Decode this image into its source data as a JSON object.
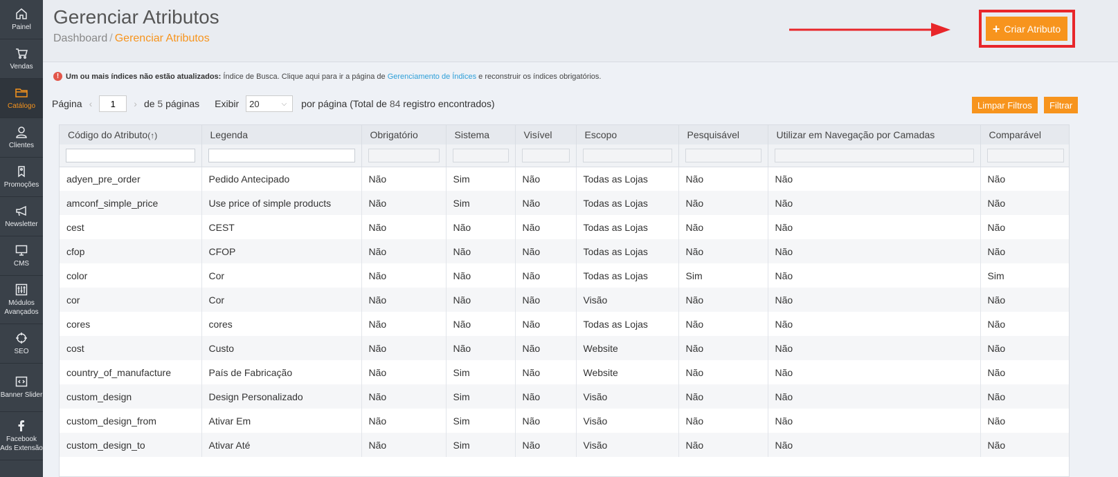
{
  "sidebar": {
    "items": [
      {
        "label": "Painel",
        "icon": "home-icon"
      },
      {
        "label": "Vendas",
        "icon": "cart-icon"
      },
      {
        "label": "Catálogo",
        "icon": "folder-icon"
      },
      {
        "label": "Clientes",
        "icon": "user-icon"
      },
      {
        "label": "Promoções",
        "icon": "tag-icon"
      },
      {
        "label": "Newsletter",
        "icon": "megaphone-icon"
      },
      {
        "label": "CMS",
        "icon": "monitor-icon"
      },
      {
        "label": "Módulos Avançados",
        "icon": "sliders-icon"
      },
      {
        "label": "SEO",
        "icon": "crosshair-icon"
      },
      {
        "label": "Banner Slider",
        "icon": "code-icon"
      },
      {
        "label": "Facebook Ads Extensão",
        "icon": "facebook-icon"
      }
    ],
    "active_index": 2
  },
  "header": {
    "title": "Gerenciar Atributos",
    "breadcrumb_root": "Dashboard",
    "breadcrumb_sep": "/",
    "breadcrumb_current": "Gerenciar Atributos",
    "create_button_label": "Criar Atributo",
    "create_button_icon": "+"
  },
  "notice": {
    "bold": "Um ou mais índices não estão atualizados:",
    "text1": "Índice de Busca. Clique aqui para ir a página de",
    "link": "Gerenciamento de Índices",
    "text2": "e reconstruir os índices obrigatórios."
  },
  "pager": {
    "page_label": "Página",
    "page_value": "1",
    "of_label": "de",
    "total_pages": "5",
    "pages_label": "páginas",
    "show_label": "Exibir",
    "per_page": "20",
    "per_page_label": "por página (Total de",
    "total_records": "84",
    "records_label": "registro encontrados)",
    "clear_filters": "Limpar Filtros",
    "filter": "Filtrar"
  },
  "grid": {
    "columns": [
      "Código do Atributo",
      "Legenda",
      "Obrigatório",
      "Sistema",
      "Visível",
      "Escopo",
      "Pesquisável",
      "Utilizar em Navegação por Camadas",
      "Comparável"
    ],
    "sort_indicator": "(↑)",
    "rows": [
      [
        "adyen_pre_order",
        "Pedido Antecipado",
        "Não",
        "Sim",
        "Não",
        "Todas as Lojas",
        "Não",
        "Não",
        "Não"
      ],
      [
        "amconf_simple_price",
        "Use price of simple products",
        "Não",
        "Sim",
        "Não",
        "Todas as Lojas",
        "Não",
        "Não",
        "Não"
      ],
      [
        "cest",
        "CEST",
        "Não",
        "Não",
        "Não",
        "Todas as Lojas",
        "Não",
        "Não",
        "Não"
      ],
      [
        "cfop",
        "CFOP",
        "Não",
        "Não",
        "Não",
        "Todas as Lojas",
        "Não",
        "Não",
        "Não"
      ],
      [
        "color",
        "Cor",
        "Não",
        "Não",
        "Não",
        "Todas as Lojas",
        "Sim",
        "Não",
        "Sim"
      ],
      [
        "cor",
        "Cor",
        "Não",
        "Não",
        "Não",
        "Visão",
        "Não",
        "Não",
        "Não"
      ],
      [
        "cores",
        "cores",
        "Não",
        "Não",
        "Não",
        "Todas as Lojas",
        "Não",
        "Não",
        "Não"
      ],
      [
        "cost",
        "Custo",
        "Não",
        "Não",
        "Não",
        "Website",
        "Não",
        "Não",
        "Não"
      ],
      [
        "country_of_manufacture",
        "País de Fabricação",
        "Não",
        "Sim",
        "Não",
        "Website",
        "Não",
        "Não",
        "Não"
      ],
      [
        "custom_design",
        "Design Personalizado",
        "Não",
        "Sim",
        "Não",
        "Visão",
        "Não",
        "Não",
        "Não"
      ],
      [
        "custom_design_from",
        "Ativar Em",
        "Não",
        "Sim",
        "Não",
        "Visão",
        "Não",
        "Não",
        "Não"
      ],
      [
        "custom_design_to",
        "Ativar Até",
        "Não",
        "Sim",
        "Não",
        "Visão",
        "Não",
        "Não",
        "Não"
      ]
    ]
  },
  "colors": {
    "accent": "#f7941d",
    "highlight": "#e8262a",
    "sidebar": "#3a4149",
    "link": "#2e9fd8"
  }
}
